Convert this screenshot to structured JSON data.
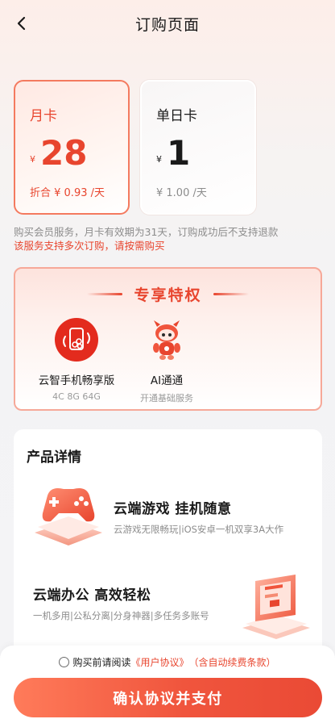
{
  "header": {
    "title": "订购页面"
  },
  "plans": [
    {
      "name": "月卡",
      "currency": "¥",
      "price": "28",
      "note": "折合 ¥ 0.93 /天",
      "selected": true
    },
    {
      "name": "单日卡",
      "currency": "¥",
      "price": "1",
      "note": "¥ 1.00 /天",
      "selected": false
    }
  ],
  "notices": {
    "line1": "购买会员服务，月卡有效期为31天，订购成功后不支持退款",
    "line2": "该服务支持多次订购，请按需购买"
  },
  "privileges": {
    "title": "专享特权",
    "items": [
      {
        "name": "云智手机畅享版",
        "sub": "4C 8G 64G",
        "icon": "cloud-phone-icon"
      },
      {
        "name": "AI通通",
        "sub": "开通基础服务",
        "icon": "ai-mascot-icon"
      }
    ]
  },
  "details": {
    "title": "产品详情",
    "features": [
      {
        "title": "云端游戏  挂机随意",
        "sub": "云游戏无限畅玩|iOS安卓一机双享3A大作",
        "icon": "gamepad-icon"
      },
      {
        "title": "云端办公  高效轻松",
        "sub": "一机多用|公私分离|分身神器|多任务多账号",
        "icon": "office-screen-icon"
      }
    ]
  },
  "agreement": {
    "prefix": "购买前请阅读",
    "link": "《用户协议》",
    "suffix": "（含自动续费条款）"
  },
  "pay_button": "确认协议并支付",
  "colors": {
    "accent": "#e8452e",
    "accent_light": "#ff7b5a"
  }
}
